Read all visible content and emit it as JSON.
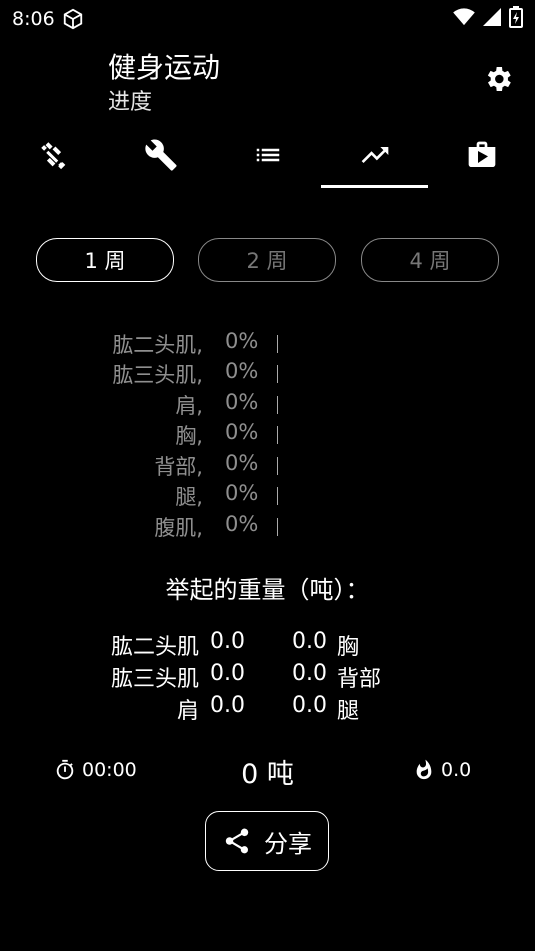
{
  "status": {
    "time": "8:06"
  },
  "app": {
    "title": "健身运动",
    "subtitle": "进度"
  },
  "tabs": [
    "dumbbell",
    "wrench",
    "list",
    "trending",
    "store"
  ],
  "periods": [
    {
      "label": "1 周"
    },
    {
      "label": "2 周"
    },
    {
      "label": "4 周"
    }
  ],
  "muscles": [
    {
      "name": "肱二头肌,",
      "pct": "0%"
    },
    {
      "name": "肱三头肌,",
      "pct": "0%"
    },
    {
      "name": "肩,",
      "pct": "0%"
    },
    {
      "name": "胸,",
      "pct": "0%"
    },
    {
      "name": "背部,",
      "pct": "0%"
    },
    {
      "name": "腿,",
      "pct": "0%"
    },
    {
      "name": "腹肌,",
      "pct": "0%"
    }
  ],
  "lifted": {
    "title": "举起的重量（吨）：",
    "rows": [
      {
        "l1": "肱二头肌",
        "v1": "0.0",
        "v2": "0.0",
        "l2": "胸"
      },
      {
        "l1": "肱三头肌",
        "v1": "0.0",
        "v2": "0.0",
        "l2": "背部"
      },
      {
        "l1": "肩",
        "v1": "0.0",
        "v2": "0.0",
        "l2": "腿"
      }
    ]
  },
  "stats": {
    "timer": "00:00",
    "total": "0 吨",
    "calories": "0.0"
  },
  "share": {
    "label": "分享"
  }
}
